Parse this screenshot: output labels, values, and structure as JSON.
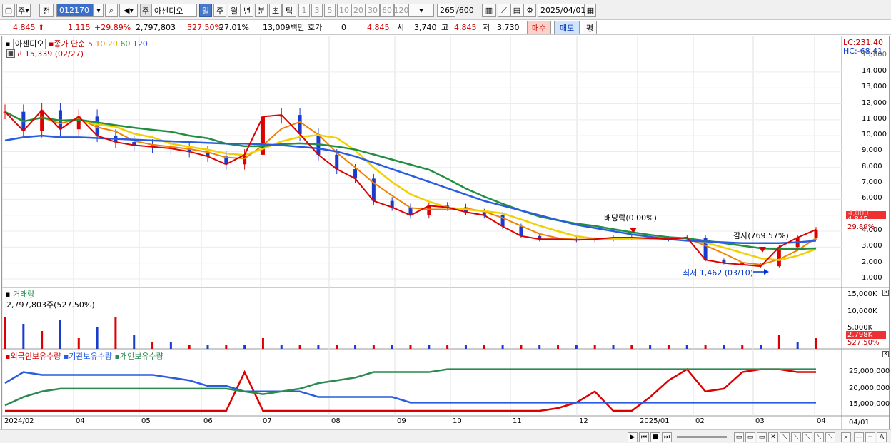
{
  "toolbar": {
    "market": "주",
    "prev": "전",
    "code": "012170",
    "name": "아센디오",
    "name_prefix": "주",
    "periods": [
      "일",
      "주",
      "월",
      "년",
      "분",
      "초",
      "틱"
    ],
    "active_period": "일",
    "intervals": [
      "1",
      "3",
      "5",
      "10",
      "20",
      "30",
      "60",
      "120"
    ],
    "count": "265",
    "count_max": "/600",
    "date": "2025/04/01"
  },
  "quote": {
    "price": "4,845",
    "change": "1,115",
    "change_pct": "+29.89%",
    "volume": "2,797,803",
    "vol_ratio": "527.50%",
    "turnover_pct": "27.01%",
    "trade_value": "13,009백만",
    "hoga_label": "호가",
    "hoga_val": "0",
    "ask": "4,845",
    "open_label": "시",
    "open": "3,740",
    "high_label": "고",
    "high": "4,845",
    "low_label": "저",
    "low": "3,730",
    "buy": "매수",
    "sell": "매도",
    "eval": "평"
  },
  "price_panel": {
    "legend_name": "아센디오",
    "legend_ma": "종가 단순",
    "ma_periods": [
      "5",
      "10",
      "20",
      "60",
      "120"
    ],
    "ma_colors": [
      "#dd0000",
      "#f08000",
      "#f0d000",
      "#209040",
      "#2a5ce0"
    ],
    "high_note": "최고 15,339 (02/27)",
    "low_note": "최저 1,462 (03/10)",
    "dividend": "배당락(0.00%)",
    "capital": "감자(769.57%)",
    "lc": "LC:231.40",
    "hc": "HC:-68.41",
    "yticks": [
      "14,000",
      "13,000",
      "12,000",
      "11,000",
      "10,000",
      "9,000",
      "8,000",
      "7,000",
      "6,000",
      "5,000",
      "4,000",
      "3,000",
      "2,000",
      "1,000"
    ],
    "price_tag": "4,845",
    "pct_tag": "29.89%",
    "top_tick": "15,000",
    "hidden_tick": "4,000"
  },
  "volume_panel": {
    "title": "거래량",
    "value": "2,797,803주(527.50%)",
    "yticks": [
      "15,000K",
      "10,000K",
      "5,000K"
    ],
    "tag_vol": "2,798K",
    "tag_pct": "527.50%"
  },
  "holding_panel": {
    "series": [
      "외국인보유수량",
      "기관보유수량",
      "개인보유수량"
    ],
    "colors": [
      "#dd0000",
      "#2a5ce0",
      "#2a8a50"
    ],
    "yticks": [
      "25,000,000",
      "20,000,000",
      "15,000,000"
    ]
  },
  "xaxis": [
    "2024/02",
    "04",
    "05",
    "06",
    "07",
    "08",
    "09",
    "10",
    "11",
    "12",
    "2025/01",
    "02",
    "03",
    "04"
  ],
  "xaxis_extra": "04/01",
  "chart_data": [
    {
      "type": "line",
      "title": "아센디오",
      "ylim": [
        1000,
        15339
      ],
      "series": [
        {
          "name": "5",
          "values": [
            11500,
            10300,
            11600,
            10400,
            11200,
            10000,
            9600,
            9400,
            9300,
            9200,
            9000,
            8700,
            8200,
            8800,
            11200,
            11300,
            10100,
            8800,
            7900,
            7300,
            5900,
            5500,
            5000,
            5600,
            5500,
            5200,
            5000,
            4300,
            3700,
            3500,
            3500,
            3450,
            3500,
            3600,
            3600,
            3550,
            3500,
            3600,
            2200,
            2000,
            1900,
            1800,
            3000,
            3600,
            4100
          ]
        },
        {
          "name": "120",
          "values": [
            9700,
            9900,
            10000,
            9900,
            9900,
            9850,
            9800,
            9750,
            9700,
            9650,
            9600,
            9550,
            9500,
            9500,
            9450,
            9400,
            9300,
            9200,
            9000,
            8700,
            8300,
            7900,
            7500,
            7100,
            6700,
            6300,
            5900,
            5600,
            5300,
            5000,
            4700,
            4400,
            4200,
            4000,
            3800,
            3650,
            3500,
            3400,
            3350,
            3300,
            3250,
            3250,
            3250,
            3300,
            3400
          ]
        }
      ]
    },
    {
      "type": "line",
      "title": "외국인보유수량",
      "ylim": [
        12000000,
        30000000
      ],
      "series": [
        {
          "name": "외국인보유수량",
          "values": [
            12000000,
            12000000,
            12000000,
            12000000,
            12000000,
            12000000,
            12000000,
            12000000,
            12000000,
            12000000,
            12000000,
            12000000,
            12000000,
            26000000,
            12000000,
            12000000,
            12000000,
            12000000,
            12000000,
            12000000,
            12000000,
            12000000,
            12000000,
            12000000,
            12000000,
            12000000,
            12000000,
            12000000,
            12000000,
            12000000,
            13000000,
            15000000,
            19000000,
            12000000,
            12000000,
            17000000,
            23000000,
            27000000,
            19000000,
            20000000,
            26000000,
            27000000,
            27000000,
            26000000,
            26000000
          ]
        }
      ]
    }
  ]
}
